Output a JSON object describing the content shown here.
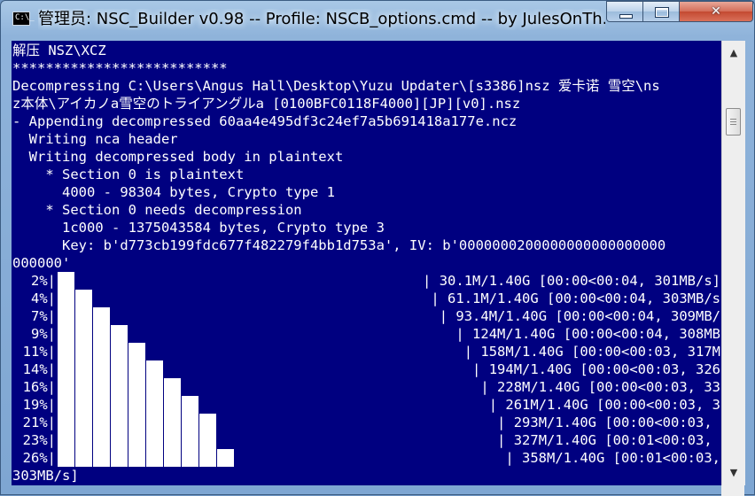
{
  "window": {
    "title": "管理员:  NSC_Builder v0.98 -- Profile: NSCB_options.cmd -- by JulesOnTh...",
    "app_icon_text": "C:\\_"
  },
  "controls": {
    "close_glyph": "✕"
  },
  "scrollbar": {
    "up_arrow": "▲",
    "down_arrow": "▼"
  },
  "console": {
    "lines": [
      "解压 NSZ\\XCZ",
      "**************************",
      "Decompressing C:\\Users\\Angus Hall\\Desktop\\Yuzu Updater\\[s3386]nsz 爱卡诺 雪空\\ns",
      "z本体\\アイカノa雪空のトライアングルa [0100BFC0118F4000][JP][v0].nsz",
      "- Appending decompressed 60aa4e495df3c24ef7a5b691418a177e.ncz",
      "  Writing nca header",
      "  Writing decompressed body in plaintext",
      "    * Section 0 is plaintext",
      "      4000 - 98304 bytes, Crypto type 1",
      "    * Section 0 needs decompression",
      "      1c000 - 1375043584 bytes, Crypto type 3",
      "      Key: b'd773cb199fdc677f482279f4bb1d753a', IV: b'0000000200000000000000000",
      "000000'"
    ],
    "progress": [
      {
        "percent": "2%|",
        "blocks": 1,
        "stats": "| 30.1M/1.40G [00:00<00:04, 301MB/s]"
      },
      {
        "percent": "4%|",
        "blocks": 2,
        "stats": "| 61.1M/1.40G [00:00<00:04, 303MB/s"
      },
      {
        "percent": "7%|",
        "blocks": 3,
        "stats": "| 93.4M/1.40G [00:00<00:04, 309MB/"
      },
      {
        "percent": "9%|",
        "blocks": 4,
        "stats": "| 124M/1.40G [00:00<00:04, 308MB"
      },
      {
        "percent": "11%|",
        "blocks": 5,
        "stats": "| 158M/1.40G [00:00<00:03, 317M"
      },
      {
        "percent": "14%|",
        "blocks": 6,
        "stats": "| 194M/1.40G [00:00<00:03, 326"
      },
      {
        "percent": "16%|",
        "blocks": 7,
        "stats": "| 228M/1.40G [00:00<00:03, 33"
      },
      {
        "percent": "19%|",
        "blocks": 8,
        "stats": "| 261M/1.40G [00:00<00:03, 3"
      },
      {
        "percent": "21%|",
        "blocks": 9,
        "stats": "| 293M/1.40G [00:00<00:03, "
      },
      {
        "percent": "23%|",
        "blocks": 9,
        "stats": "| 327M/1.40G [00:01<00:03, "
      },
      {
        "percent": "26%|",
        "blocks": 10,
        "stats": "| 358M/1.40G [00:01<00:03,"
      }
    ],
    "tail": "303MB/s]"
  },
  "colors": {
    "console_bg": "#000080",
    "console_fg": "#ffffff"
  }
}
